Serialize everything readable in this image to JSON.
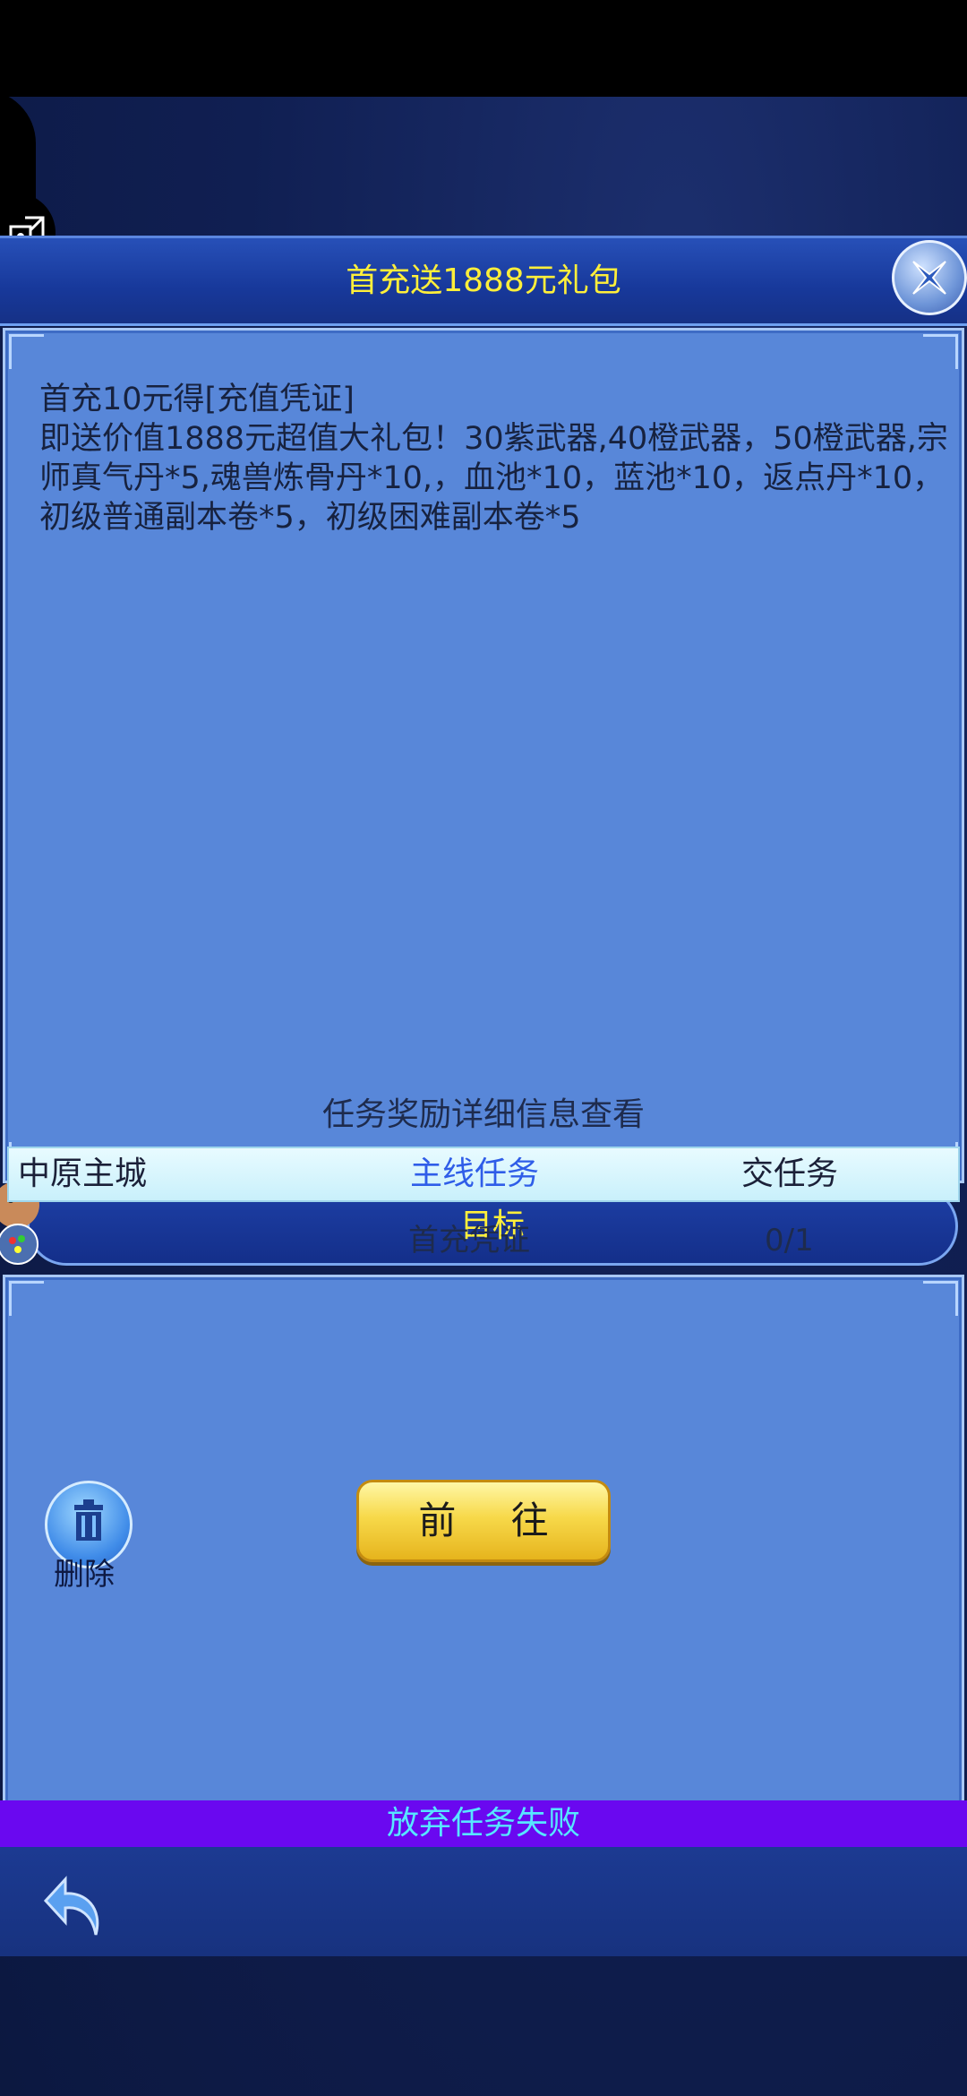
{
  "dialog": {
    "title": "首充送1888元礼包"
  },
  "description": {
    "line1": "首充10元得[充值凭证]",
    "line2": "即送价值1888元超值大礼包！30紫武器,40橙武器，50橙武器,宗师真气丹*5,魂兽炼骨丹*10,，血池*10，蓝池*10，返点丹*10，初级普通副本卷*5，初级困难副本卷*5"
  },
  "goal": {
    "label": "目标"
  },
  "task": {
    "section_title": "任务奖励详细信息查看",
    "row": {
      "city": "中原主城",
      "type": "主线任务",
      "action": "交任务"
    },
    "item": {
      "name": "首充凭证",
      "progress": "0/1"
    }
  },
  "buttons": {
    "go": "前 往",
    "delete": "删除"
  },
  "status": {
    "fail_message": "放弃任务失败"
  },
  "colors": {
    "title_text": "#ffef3a",
    "panel_bg": "#5887d9",
    "fail_bar": "#6a08f0",
    "fail_text": "#57e6ff",
    "task_type": "#2f5de8"
  },
  "icons": {
    "close": "close-x-icon",
    "float": "puzzle-expand-icon",
    "delete": "trash-icon",
    "back": "back-arrow-icon"
  }
}
